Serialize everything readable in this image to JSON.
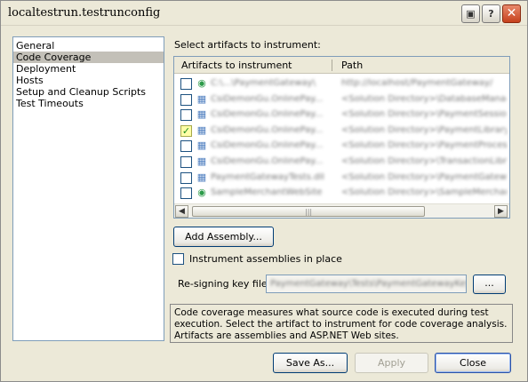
{
  "window": {
    "title": "localtestrun.testrunconfig",
    "buttons": {
      "help": "?",
      "close": "✕"
    }
  },
  "nav": {
    "items": [
      "General",
      "Code Coverage",
      "Deployment",
      "Hosts",
      "Setup and Cleanup Scripts",
      "Test Timeouts"
    ],
    "selected": "Code Coverage"
  },
  "artifacts": {
    "section_label": "Select artifacts to instrument:",
    "columns": [
      "Artifacts to instrument",
      "Path"
    ],
    "rows": [
      {
        "checked": false,
        "name": "C:\\...\\PaymentGateway\\",
        "path": "http://localhost/PaymentGateway/",
        "icon": "web-icon"
      },
      {
        "checked": false,
        "name": "CsiDemonGu.OnlinePay...",
        "path": "<Solution Directory>\\DatabaseManager...",
        "icon": "assembly-icon"
      },
      {
        "checked": false,
        "name": "CsiDemonGu.OnlinePay...",
        "path": "<Solution Directory>\\PaymentSessionV...",
        "icon": "assembly-icon"
      },
      {
        "checked": true,
        "name": "CsiDemonGu.OnlinePay...",
        "path": "<Solution Directory>\\PaymentLibrarySo...",
        "icon": "assembly-icon"
      },
      {
        "checked": false,
        "name": "CsiDemonGu.OnlinePay...",
        "path": "<Solution Directory>\\PaymentProcessor...",
        "icon": "assembly-icon"
      },
      {
        "checked": false,
        "name": "CsiDemonGu.OnlinePay...",
        "path": "<Solution Directory>\\TransactionLibrary...",
        "icon": "assembly-icon"
      },
      {
        "checked": false,
        "name": "PaymentGatewayTests.dll",
        "path": "<Solution Directory>\\PaymentGateway...",
        "icon": "assembly-icon"
      },
      {
        "checked": false,
        "name": "SampleMerchantWebSite",
        "path": "<Solution Directory>\\SampleMerchantWe...",
        "icon": "web-icon"
      }
    ],
    "scroll": {
      "left_arrow": "◀",
      "right_arrow": "▶",
      "grip": "|||"
    }
  },
  "add_assembly_label": "Add Assembly...",
  "instrument_in_place_label": "Instrument assemblies in place",
  "resign": {
    "label": "Re-signing key file:",
    "value": "PaymentGateway\\Tests\\PaymentGatewayKey",
    "browse_label": "..."
  },
  "description": "Code coverage measures what source code is executed during test execution. Select the artifact to instrument for code coverage analysis. Artifacts are assemblies and ASP.NET Web sites.",
  "footer": {
    "save_as": "Save As...",
    "apply": "Apply",
    "close": "Close"
  }
}
